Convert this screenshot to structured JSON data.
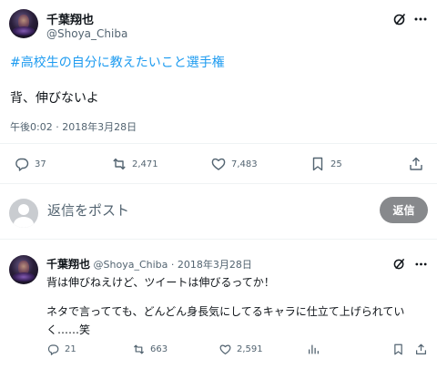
{
  "tweet": {
    "name": "千葉翔也",
    "handle": "@Shoya_Chiba",
    "hashtag": "#高校生の自分に教えたいこと選手権",
    "text": "背、伸びないよ",
    "meta": "午後0:02 · 2018年3月28日",
    "stats": {
      "replies": "37",
      "reposts": "2,471",
      "likes": "7,483",
      "bookmarks": "25"
    }
  },
  "compose": {
    "placeholder": "返信をポスト",
    "button": "返信"
  },
  "reply": {
    "name": "千葉翔也",
    "handle": "@Shoya_Chiba",
    "dot": "·",
    "date": "2018年3月28日",
    "line1": "背は伸びねえけど、ツイートは伸びるってか！",
    "line2": "ネタで言ってても、どんどん身長気にしてるキャラに仕立て上げられてい",
    "line3": "く……笑",
    "stats": {
      "replies": "21",
      "reposts": "663",
      "likes": "2,591"
    }
  },
  "colors": {
    "link": "#1d9bf0",
    "secondary_text": "#536471",
    "reply_button_bg": "#87898c",
    "divider": "#eff3f4"
  },
  "icons": [
    "grok-icon",
    "more-icon",
    "reply-icon",
    "repost-icon",
    "like-icon",
    "views-icon",
    "bookmark-icon",
    "share-icon"
  ]
}
